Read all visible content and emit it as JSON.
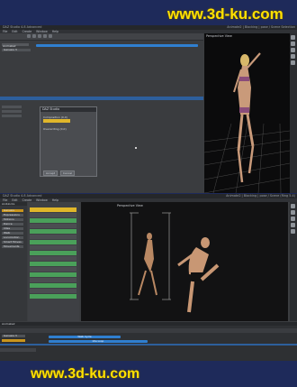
{
  "watermark_top": "www.3d-ku.com",
  "watermark_bottom": "www.3d-ku.com",
  "window1": {
    "title": "DAZ Studio 4.8 Advanced",
    "status_right": "Animate2 | Blocking | pose / Scene Selection",
    "menu": [
      "File",
      "Edit",
      "Create",
      "Window",
      "Help",
      "Tools",
      "Scene",
      "View"
    ],
    "timeline_label": "Animate2",
    "track_name": "Genesis 3",
    "dialog": {
      "title": "DAZ Studio",
      "field1_label": "Composition (0,0)",
      "field2_label": "Overwriting (0,0)",
      "accept": "Accept",
      "cancel": "Cancel"
    },
    "viewport_label": "Perspective View"
  },
  "window2": {
    "title": "DAZ Studio 4.8 Advanced",
    "status_right": "Animate2 | Blocking | pose / Scene (Ring 5.4)",
    "menu": [
      "File",
      "Edit",
      "Create",
      "Window",
      "Help",
      "Tools",
      "Scene",
      "View"
    ],
    "left_panel_header": "Aniblocks",
    "left_items": [
      "Genesis",
      "Expressions",
      "Motions",
      "Dance",
      "Idles",
      "Walk",
      "Locomotion",
      "Smart Moves",
      "Movements"
    ],
    "viewport_label": "Perspective View",
    "timeline_tab": "Animate2",
    "track1": "Genesis 3",
    "block_label": "Walk Cycle",
    "block2_label": "Idle Loop"
  },
  "colors": {
    "bg": "#1e2a5a",
    "watermark": "#ffe100",
    "accent_blue": "#2f7fd0",
    "tag_yellow": "#e0b62a",
    "tag_green": "#4aa05a"
  }
}
